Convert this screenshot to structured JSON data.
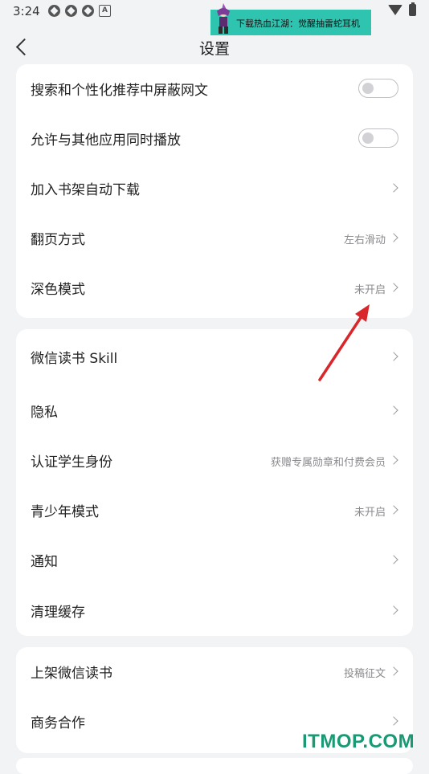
{
  "status_bar": {
    "time": "3:24"
  },
  "ad_banner": {
    "text": "下载热血江湖：觉醒抽雷蛇耳机"
  },
  "header": {
    "title": "设置"
  },
  "section1": {
    "items": [
      {
        "label": "搜索和个性化推荐中屏蔽网文",
        "control": "toggle-off"
      },
      {
        "label": "允许与其他应用同时播放",
        "control": "toggle-off"
      },
      {
        "label": "加入书架自动下载",
        "value": ""
      },
      {
        "label": "翻页方式",
        "value": "左右滑动"
      },
      {
        "label": "深色模式",
        "value": "未开启"
      }
    ]
  },
  "section2": {
    "items": [
      {
        "label": "微信读书 Skill",
        "value": ""
      },
      {
        "label": "隐私",
        "value": ""
      },
      {
        "label": "认证学生身份",
        "value": "获赠专属勋章和付费会员"
      },
      {
        "label": "青少年模式",
        "value": "未开启"
      },
      {
        "label": "通知",
        "value": ""
      },
      {
        "label": "清理缓存",
        "value": ""
      }
    ]
  },
  "section3": {
    "items": [
      {
        "label": "上架微信读书",
        "value": "投稿征文"
      },
      {
        "label": "商务合作",
        "value": ""
      }
    ]
  },
  "watermark": "ITMOP.COM",
  "colors": {
    "background": "#f2f3f5",
    "card": "#ffffff",
    "annotation_arrow": "#d8262b",
    "watermark": "#1a9a74",
    "ad": "#2fc4b0"
  }
}
